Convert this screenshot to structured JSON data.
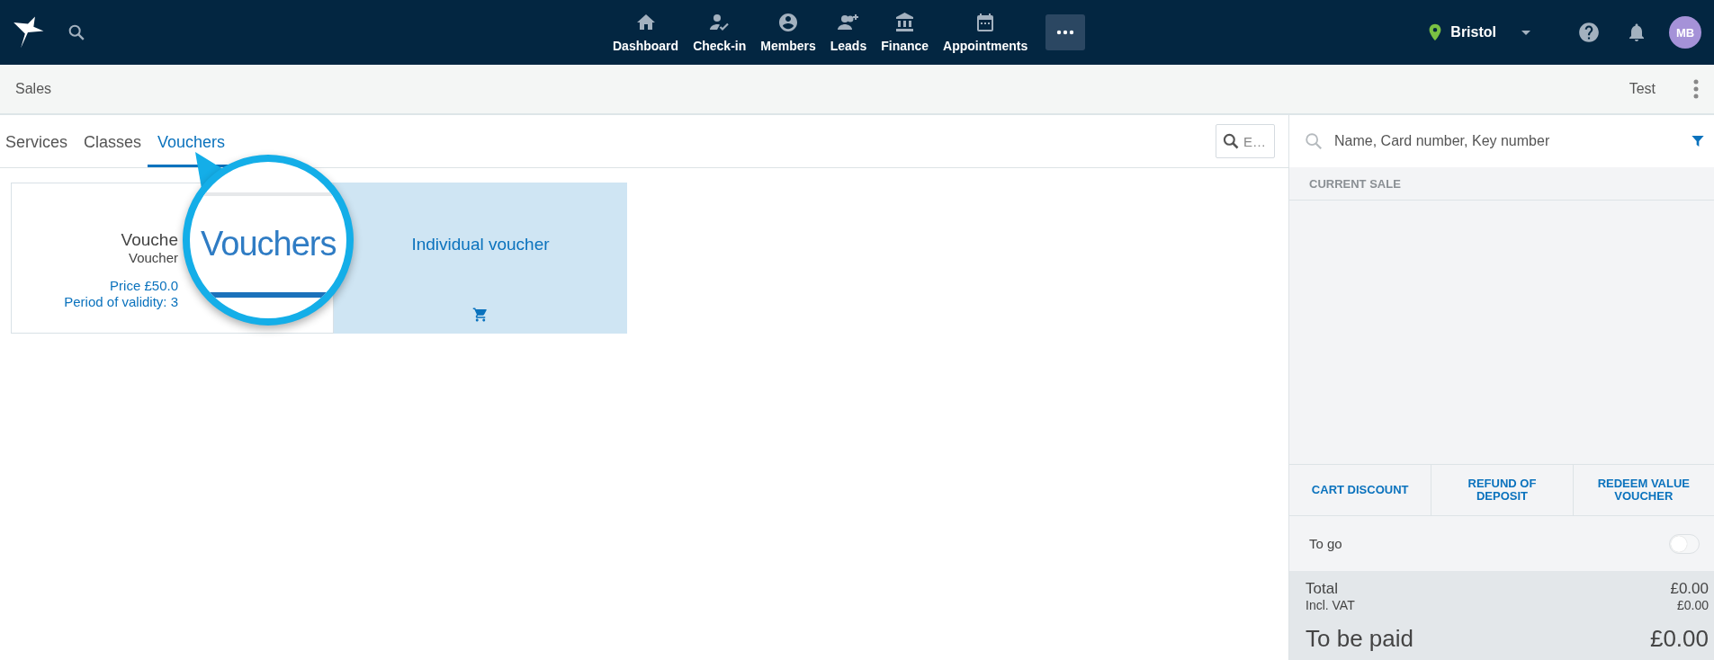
{
  "top_bar": {
    "nav_items": [
      {
        "label": "Dashboard"
      },
      {
        "label": "Check-in"
      },
      {
        "label": "Members"
      },
      {
        "label": "Leads"
      },
      {
        "label": "Finance"
      },
      {
        "label": "Appointments"
      }
    ],
    "location": "Bristol",
    "avatar": "MB"
  },
  "sub_header": {
    "title": "Sales",
    "action": "Test"
  },
  "tabs": [
    {
      "label": "Services",
      "selected": false
    },
    {
      "label": "Classes",
      "selected": false
    },
    {
      "label": "Vouchers",
      "selected": true
    }
  ],
  "catalog_search": {
    "placeholder": "E…"
  },
  "cards": [
    {
      "title": "Vouche",
      "subtitle": "Voucher",
      "price": "Price £50.0",
      "validity": "Period of validity: 3",
      "highlighted": false
    },
    {
      "title": "Individual voucher",
      "highlighted": true
    }
  ],
  "callout": {
    "text": "Vouchers"
  },
  "sale_panel": {
    "search": {
      "placeholder": "Name, Card number, Key number"
    },
    "section_title": "CURRENT SALE",
    "actions": [
      "CART DISCOUNT",
      "REFUND OF DEPOSIT",
      "REDEEM VALUE VOUCHER"
    ],
    "to_go": {
      "label": "To go",
      "on": false
    },
    "totals": [
      {
        "label": "Total",
        "value": "£0.00",
        "kind": "main"
      },
      {
        "label": "Incl. VAT",
        "value": "£0.00",
        "kind": "sub"
      },
      {
        "label": "To be paid",
        "value": "£0.00",
        "kind": "grand"
      }
    ]
  }
}
